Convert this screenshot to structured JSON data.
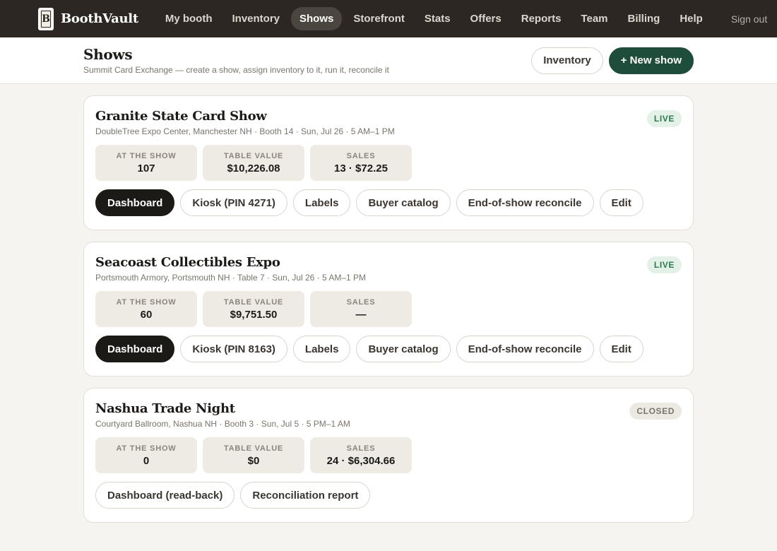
{
  "app": {
    "name": "BoothVault",
    "logo_letter": "B"
  },
  "nav": {
    "items": [
      {
        "label": "My booth",
        "active": false
      },
      {
        "label": "Inventory",
        "active": false
      },
      {
        "label": "Shows",
        "active": true
      },
      {
        "label": "Storefront",
        "active": false
      },
      {
        "label": "Stats",
        "active": false
      },
      {
        "label": "Offers",
        "active": false
      },
      {
        "label": "Reports",
        "active": false
      },
      {
        "label": "Team",
        "active": false
      },
      {
        "label": "Billing",
        "active": false
      },
      {
        "label": "Help",
        "active": false
      }
    ],
    "signout": "Sign out"
  },
  "header": {
    "title": "Shows",
    "subtitle": "Summit Card Exchange — create a show, assign inventory to it, run it, reconcile it",
    "inventory_button": "Inventory",
    "new_show_button": "+ New show"
  },
  "colors": {
    "accent": "#1f4d3b",
    "nav_bg": "#2c2723",
    "live": "#2d7a4c"
  },
  "shows": [
    {
      "title": "Granite State Card Show",
      "meta": "DoubleTree Expo Center, Manchester NH · Booth 14 · Sun, Jul 26 · 5 AM–1 PM",
      "status": "LIVE",
      "stats": [
        {
          "label": "AT THE SHOW",
          "value": "107"
        },
        {
          "label": "TABLE VALUE",
          "value": "$10,226.08"
        },
        {
          "label": "SALES",
          "value": "13 · $72.25"
        }
      ],
      "actions": [
        "Dashboard",
        "Kiosk (PIN 4271)",
        "Labels",
        "Buyer catalog",
        "End-of-show reconcile",
        "Edit"
      ]
    },
    {
      "title": "Seacoast Collectibles Expo",
      "meta": "Portsmouth Armory, Portsmouth NH · Table 7 · Sun, Jul 26 · 5 AM–1 PM",
      "status": "LIVE",
      "stats": [
        {
          "label": "AT THE SHOW",
          "value": "60"
        },
        {
          "label": "TABLE VALUE",
          "value": "$9,751.50"
        },
        {
          "label": "SALES",
          "value": "—"
        }
      ],
      "actions": [
        "Dashboard",
        "Kiosk (PIN 8163)",
        "Labels",
        "Buyer catalog",
        "End-of-show reconcile",
        "Edit"
      ]
    },
    {
      "title": "Nashua Trade Night",
      "meta": "Courtyard Ballroom, Nashua NH · Booth 3 · Sun, Jul 5 · 5 PM–1 AM",
      "status": "CLOSED",
      "stats": [
        {
          "label": "AT THE SHOW",
          "value": "0"
        },
        {
          "label": "TABLE VALUE",
          "value": "$0"
        },
        {
          "label": "SALES",
          "value": "24 · $6,304.66"
        }
      ],
      "actions": [
        "Dashboard (read-back)",
        "Reconciliation report"
      ]
    }
  ]
}
